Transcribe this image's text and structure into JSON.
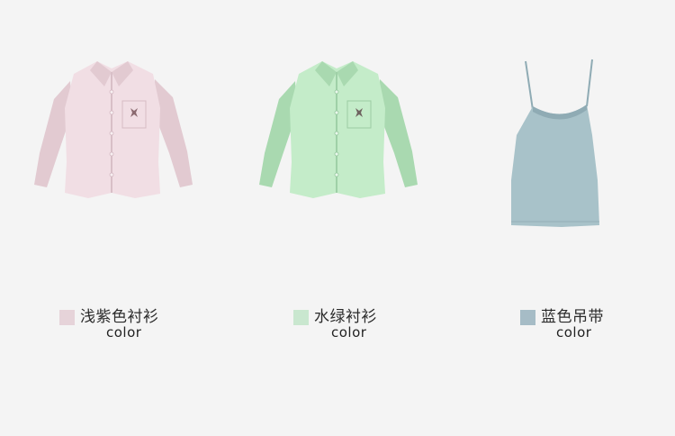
{
  "products": [
    {
      "name": "浅紫色衬衫",
      "subtitle": "color",
      "swatch_color": "#e6d3d9",
      "garment_color": "#f1dee4",
      "garment_shade": "#e2cad1",
      "icon": "pink-shirt-image"
    },
    {
      "name": "水绿衬衫",
      "subtitle": "color",
      "swatch_color": "#c9e7cf",
      "garment_color": "#c4ecc9",
      "garment_shade": "#a9d9b0",
      "icon": "green-shirt-image"
    },
    {
      "name": "蓝色吊带",
      "subtitle": "color",
      "swatch_color": "#a6bcc6",
      "garment_color": "#a8c2c9",
      "garment_shade": "#8fabb4",
      "icon": "blue-camisole-image"
    }
  ]
}
